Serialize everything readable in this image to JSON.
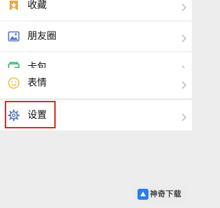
{
  "menu": {
    "favorites_label": "收藏",
    "moments_label": "朋友圈",
    "cards_label": "卡包",
    "stickers_label": "表情",
    "settings_label": "设置"
  },
  "watermark": {
    "text": "神奇下载"
  },
  "colors": {
    "background": "#ededed",
    "row": "#ffffff",
    "highlight": "#e02424",
    "favorites_icon": "#f2a43a",
    "moments_icon": "#4e77c9",
    "cards_icon": "#27b56a",
    "stickers_icon": "#f0c23b",
    "settings_icon": "#5c7fb5"
  }
}
